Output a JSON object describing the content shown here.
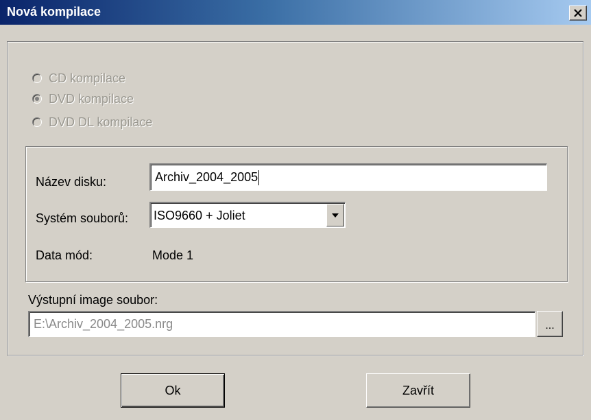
{
  "window": {
    "title": "Nová kompilace",
    "close_label": "×"
  },
  "compilation_type": {
    "options": [
      {
        "label": "CD kompilace",
        "checked": false,
        "enabled": false
      },
      {
        "label": "DVD kompilace",
        "checked": true,
        "enabled": false
      },
      {
        "label": "DVD DL kompilace",
        "checked": false,
        "enabled": false
      }
    ]
  },
  "disc_settings": {
    "disc_name_label": "Název disku:",
    "disc_name_value": "Archiv_2004_2005",
    "file_system_label": "Systém souborů:",
    "file_system_value": "ISO9660 + Joliet",
    "data_mode_label": "Data mód:",
    "data_mode_value": "Mode 1"
  },
  "output": {
    "label": "Výstupní image soubor:",
    "path_value": "E:\\Archiv_2004_2005.nrg",
    "browse_label": "..."
  },
  "buttons": {
    "ok_label": "Ok",
    "close_label": "Zavřít"
  }
}
